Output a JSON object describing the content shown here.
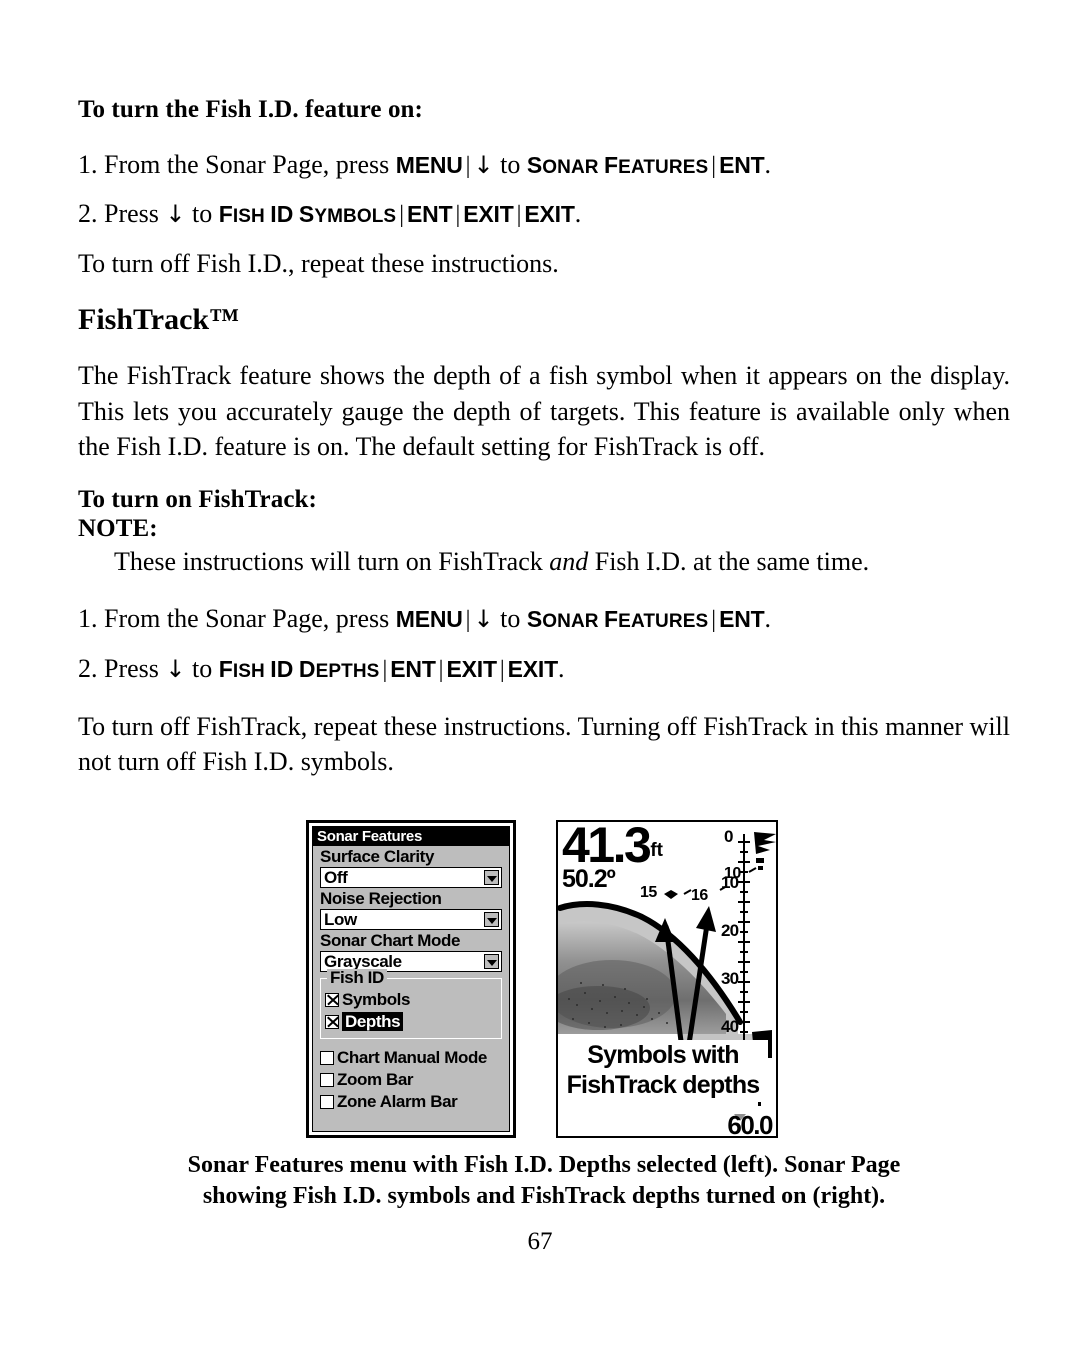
{
  "document": {
    "page_number": "67"
  },
  "sections": {
    "fishid_heading": "To turn the Fish I.D. feature on:",
    "fishid_step1": {
      "num": "1.",
      "lead": "From the Sonar Page, press",
      "key1": "MENU",
      "arrow": "↓",
      "to": "to",
      "menu1_cap": "S",
      "menu1_rest": "ONAR",
      "menu2_cap": "F",
      "menu2_rest": "EATURES",
      "key2": "ENT",
      "period": "."
    },
    "fishid_step2": {
      "num": "2.",
      "lead": "Press",
      "arrow": "↓",
      "to": "to",
      "menu1_cap": "F",
      "menu1_rest": "ISH",
      "menu2": "ID",
      "menu3_cap": "S",
      "menu3_rest": "YMBOLS",
      "key1": "ENT",
      "key2": "EXIT",
      "key3": "EXIT",
      "period": "."
    },
    "fishid_turnoff": "To turn off Fish I.D., repeat these instructions.",
    "fishtrack_title": "FishTrack™",
    "fishtrack_para": "The FishTrack feature shows the depth of a fish symbol when it appears on the display. This lets you accurately gauge the depth of targets. This feature is available only when the Fish I.D. feature is on. The default setting for FishTrack is off.",
    "fishtrack_heading": "To turn on FishTrack:",
    "note_label": "NOTE:",
    "note_text_before": "These instructions will turn on FishTrack",
    "note_text_italic": "and",
    "note_text_after": "Fish I.D. at the same time.",
    "fishtrack_step1": {
      "num": "1.",
      "lead": "From the Sonar Page, press",
      "key1": "MENU",
      "arrow": "↓",
      "to": "to",
      "menu1_cap": "S",
      "menu1_rest": "ONAR",
      "menu2_cap": "F",
      "menu2_rest": "EATURES",
      "key2": "ENT",
      "period": "."
    },
    "fishtrack_step2": {
      "num": "2.",
      "lead": "Press",
      "arrow": "↓",
      "to": "to",
      "menu1_cap": "F",
      "menu1_rest": "ISH",
      "menu2": "ID",
      "menu3_cap": "D",
      "menu3_rest": "EPTHS",
      "key1": "ENT",
      "key2": "EXIT",
      "key3": "EXIT",
      "period": "."
    },
    "fishtrack_turnoff": "To turn off FishTrack, repeat these instructions. Turning off FishTrack in this manner will not turn off Fish I.D. symbols."
  },
  "figure": {
    "menu": {
      "title": "Sonar Features",
      "fields": [
        {
          "label": "Surface Clarity",
          "value": "Off"
        },
        {
          "label": "Noise Rejection",
          "value": "Low"
        },
        {
          "label": "Sonar Chart Mode",
          "value": "Grayscale"
        }
      ],
      "group": {
        "title": "Fish ID",
        "items": [
          {
            "label": "Symbols",
            "checked": true,
            "selected": false
          },
          {
            "label": "Depths",
            "checked": true,
            "selected": true
          }
        ]
      },
      "checkboxes": [
        {
          "label": "Chart Manual Mode",
          "checked": false
        },
        {
          "label": "Zoom Bar",
          "checked": false
        },
        {
          "label": "Zone Alarm Bar",
          "checked": false
        }
      ]
    },
    "sonar": {
      "depth_value": "41.3",
      "depth_unit": "ft",
      "temperature": "50.2º",
      "range_value": "60.0",
      "fish_depths": [
        "15",
        "16",
        "10"
      ],
      "overlay_caption_line1": "Symbols with",
      "overlay_caption_line2": "FishTrack depths",
      "scale_labels": [
        "0",
        "10",
        "20",
        "30",
        "40"
      ]
    },
    "caption_line1": "Sonar Features menu with Fish I.D. Depths selected (left). Sonar Page",
    "caption_line2": "showing Fish I.D. symbols and FishTrack depths turned on (right)."
  },
  "colors": {
    "page_bg": "#ffffff",
    "ink": "#000000",
    "lcd_gray": "#bdbdbd",
    "lcd_mid": "#a8a8a8",
    "lcd_dark": "#4a4a4a"
  }
}
